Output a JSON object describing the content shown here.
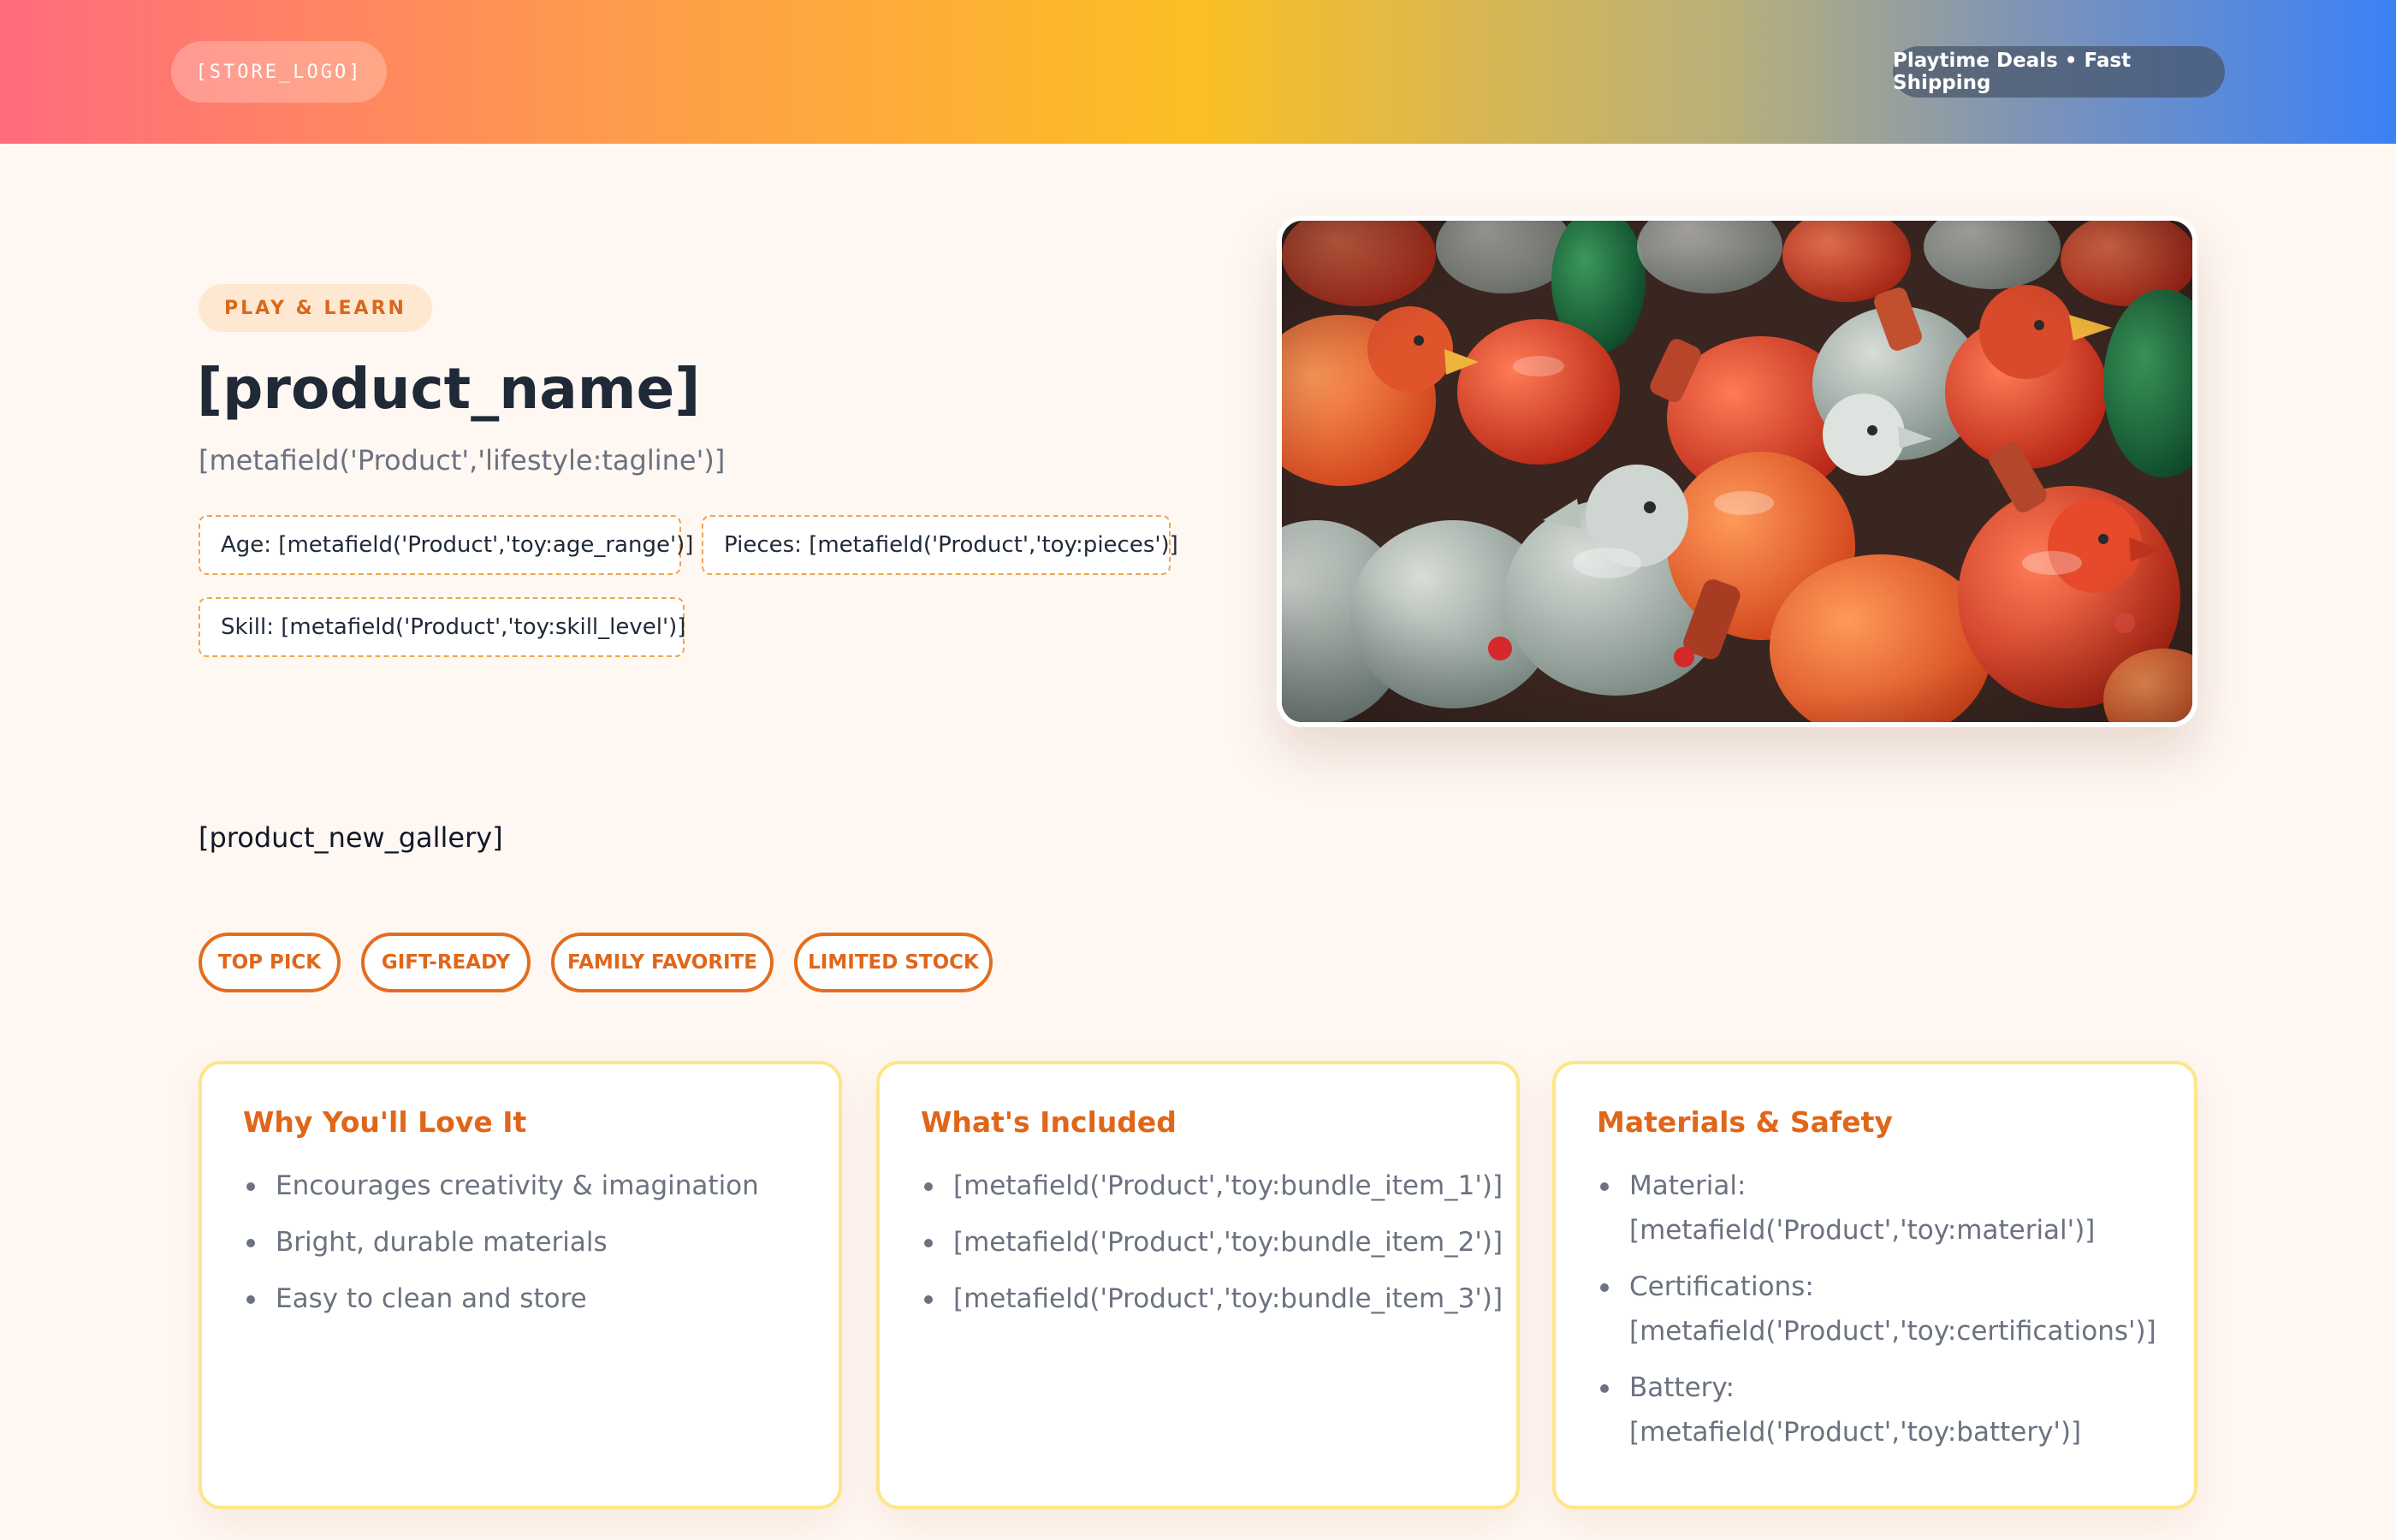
{
  "header": {
    "logo": "[STORE_LOGO]",
    "promo": "Playtime Deals • Fast Shipping"
  },
  "hero": {
    "kicker": "PLAY & LEARN",
    "title": "[product_name]",
    "tagline": "[metafield('Product','lifestyle:tagline')]",
    "specs": {
      "age": "Age: [metafield('Product','toy:age_range')]",
      "pieces": "Pieces: [metafield('Product','toy:pieces')]",
      "skill": "Skill: [metafield('Product','toy:skill_level')]"
    }
  },
  "gallery": "[product_new_gallery]",
  "badges": [
    "TOP PICK",
    "GIFT-READY",
    "FAMILY FAVORITE",
    "LIMITED STOCK"
  ],
  "cards": [
    {
      "title": "Why You'll Love It",
      "items": [
        "Encourages creativity & imagination",
        "Bright, durable materials",
        "Easy to clean and store"
      ]
    },
    {
      "title": "What's Included",
      "items": [
        "[metafield('Product','toy:bundle_item_1')]",
        "[metafield('Product','toy:bundle_item_2')]",
        "[metafield('Product','toy:bundle_item_3')]"
      ]
    },
    {
      "title": "Materials & Safety",
      "items": [
        {
          "label": "Material:",
          "value": "[metafield('Product','toy:material')]"
        },
        {
          "label": "Certifications:",
          "value": "[metafield('Product','toy:certifications')]"
        },
        {
          "label": "Battery:",
          "value": "[metafield('Product','toy:battery')]"
        }
      ]
    }
  ],
  "colors": {
    "accent": "#e0661a",
    "background": "#fff7f2",
    "spec_border": "#f0a64a",
    "card_border": "#fde68a"
  }
}
